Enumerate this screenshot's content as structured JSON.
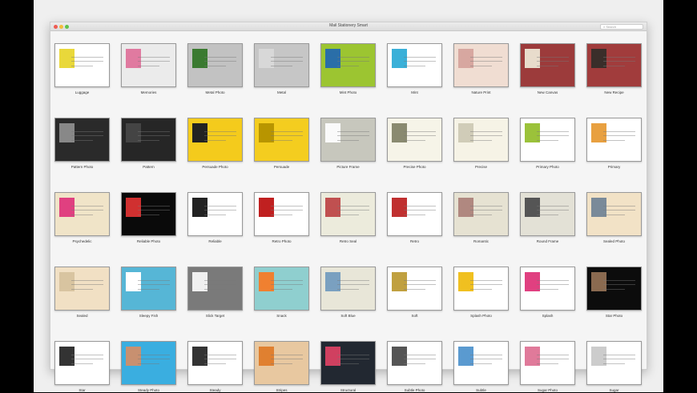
{
  "window": {
    "title": "Mail Stationery Smart",
    "search_placeholder": "Search"
  },
  "templates": [
    {
      "name": "Luggage",
      "color": "#ffffff",
      "accent": "#e9d83a"
    },
    {
      "name": "Memories",
      "color": "#ebebeb",
      "accent": "#e07aa0"
    },
    {
      "name": "Metal Photo",
      "color": "#c2c2c2",
      "accent": "#3a7a30"
    },
    {
      "name": "Metal",
      "color": "#c6c6c6",
      "accent": "#d8d8d8"
    },
    {
      "name": "Mint Photo",
      "color": "#9cc531",
      "accent": "#2a6ea8"
    },
    {
      "name": "Mint",
      "color": "#ffffff",
      "accent": "#3ab0d8"
    },
    {
      "name": "Nature Print",
      "color": "#f0ddd2",
      "accent": "#d7a7a0"
    },
    {
      "name": "New Canvas",
      "color": "#9c3b3b",
      "accent": "#e8dccc"
    },
    {
      "name": "New Recipe",
      "color": "#a13c3c",
      "accent": "#3a2e2a"
    },
    {
      "name": "Pattern Photo",
      "color": "#2a2a2a",
      "accent": "#888888"
    },
    {
      "name": "Pattern",
      "color": "#262626",
      "accent": "#444444"
    },
    {
      "name": "Persuade Photo",
      "color": "#f4cb1c",
      "accent": "#222222"
    },
    {
      "name": "Persuade",
      "color": "#f4cd1f",
      "accent": "#b89500"
    },
    {
      "name": "Picture Frame",
      "color": "#c7c7bd",
      "accent": "#fafafa"
    },
    {
      "name": "Precise Photo",
      "color": "#f6f4e8",
      "accent": "#8a8a70"
    },
    {
      "name": "Precise",
      "color": "#f6f3e6",
      "accent": "#d0ccb8"
    },
    {
      "name": "Primary Photo",
      "color": "#ffffff",
      "accent": "#9bc23a"
    },
    {
      "name": "Primary",
      "color": "#ffffff",
      "accent": "#e8a040"
    },
    {
      "name": "Psychedelic",
      "color": "#f0e4c8",
      "accent": "#e04080"
    },
    {
      "name": "Reliable Photo",
      "color": "#0a0a0a",
      "accent": "#d03030"
    },
    {
      "name": "Reliable",
      "color": "#ffffff",
      "accent": "#222222"
    },
    {
      "name": "Retro Photo",
      "color": "#ffffff",
      "accent": "#c02020"
    },
    {
      "name": "Retro Seal",
      "color": "#ecebdc",
      "accent": "#c05050"
    },
    {
      "name": "Retro",
      "color": "#ffffff",
      "accent": "#c03030"
    },
    {
      "name": "Romantic",
      "color": "#e6e2d2",
      "accent": "#b08880"
    },
    {
      "name": "Round Frame",
      "color": "#e3e1d6",
      "accent": "#555555"
    },
    {
      "name": "Sealed Photo",
      "color": "#f2e2c6",
      "accent": "#7a8a99"
    },
    {
      "name": "Sealed",
      "color": "#f1e0c4",
      "accent": "#d8c4a0"
    },
    {
      "name": "Sleepy Fish",
      "color": "#56b6d6",
      "accent": "#ffffff"
    },
    {
      "name": "Slick Target",
      "color": "#7a7a7a",
      "accent": "#f0f0f0"
    },
    {
      "name": "Snack",
      "color": "#8fcfcf",
      "accent": "#f08030"
    },
    {
      "name": "Soft Blue",
      "color": "#e8e6d8",
      "accent": "#7aa0c0"
    },
    {
      "name": "Soft",
      "color": "#ffffff",
      "accent": "#c0a040"
    },
    {
      "name": "Splash Photo",
      "color": "#ffffff",
      "accent": "#f0c020"
    },
    {
      "name": "Splash",
      "color": "#ffffff",
      "accent": "#e04080"
    },
    {
      "name": "Star Photo",
      "color": "#0c0c0c",
      "accent": "#8a6a50"
    },
    {
      "name": "Star",
      "color": "#ffffff",
      "accent": "#333333"
    },
    {
      "name": "Steady Photo",
      "color": "#3aaee0",
      "accent": "#c89070"
    },
    {
      "name": "Steady",
      "color": "#ffffff",
      "accent": "#333333"
    },
    {
      "name": "Stripes",
      "color": "#e8c8a0",
      "accent": "#e08030"
    },
    {
      "name": "Structural",
      "color": "#222831",
      "accent": "#d04060"
    },
    {
      "name": "Subtle Photo",
      "color": "#ffffff",
      "accent": "#555555"
    },
    {
      "name": "Subtle",
      "color": "#ffffff",
      "accent": "#5a9ad0"
    },
    {
      "name": "Sugar Photo",
      "color": "#ffffff",
      "accent": "#e07a9a"
    },
    {
      "name": "Sugar",
      "color": "#ffffff",
      "accent": "#cccccc"
    }
  ]
}
